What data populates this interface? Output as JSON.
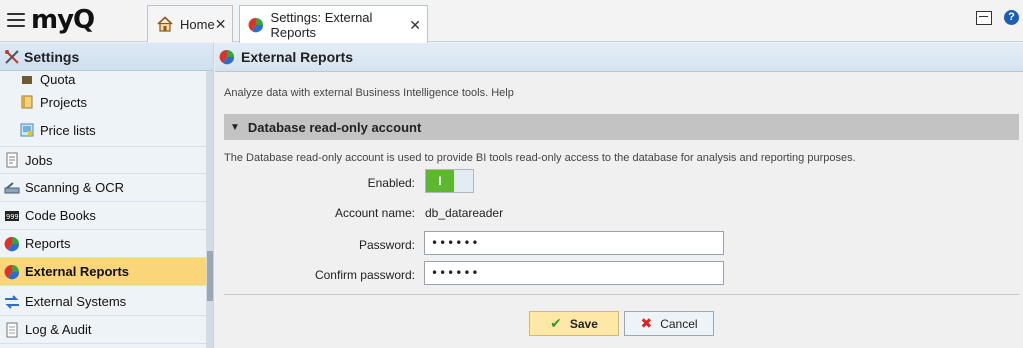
{
  "app": {
    "logo": "myQ"
  },
  "tabs": [
    {
      "label": "Home",
      "icon": "home-icon"
    },
    {
      "label": "Settings: External Reports",
      "icon": "pie-chart-icon"
    }
  ],
  "header_icons": {
    "monitor": "monitor-icon",
    "help": "?"
  },
  "sidebar": {
    "title": "Settings",
    "items": [
      {
        "label": "Quota",
        "icon": "quota-icon"
      },
      {
        "label": "Projects",
        "icon": "projects-icon"
      },
      {
        "label": "Price lists",
        "icon": "price-list-icon"
      },
      {
        "label": "Jobs",
        "icon": "jobs-icon"
      },
      {
        "label": "Scanning & OCR",
        "icon": "scanner-icon"
      },
      {
        "label": "Code Books",
        "icon": "code-books-icon"
      },
      {
        "label": "Reports",
        "icon": "pie-chart-icon"
      },
      {
        "label": "External Reports",
        "icon": "pie-chart-icon",
        "active": true
      },
      {
        "label": "External Systems",
        "icon": "external-systems-icon"
      },
      {
        "label": "Log & Audit",
        "icon": "log-icon"
      }
    ]
  },
  "main": {
    "title": "External Reports",
    "description": "Analyze data with external Business Intelligence tools. Help",
    "section": {
      "title": "Database read-only account",
      "description": "The Database read-only account is used to provide BI tools read-only access to the database for analysis and reporting purposes."
    },
    "form": {
      "enabled_label": "Enabled:",
      "toggle_text": "I",
      "account_label": "Account name:",
      "account_value": "db_datareader",
      "password_label": "Password:",
      "password_value": "••••••",
      "confirm_label": "Confirm password:",
      "confirm_value": "••••••"
    },
    "buttons": {
      "save": "Save",
      "cancel": "Cancel"
    }
  },
  "colors": {
    "active_item": "#fbd57a",
    "toggle_on": "#5cb82f",
    "save_bg": "#fde8a8"
  }
}
